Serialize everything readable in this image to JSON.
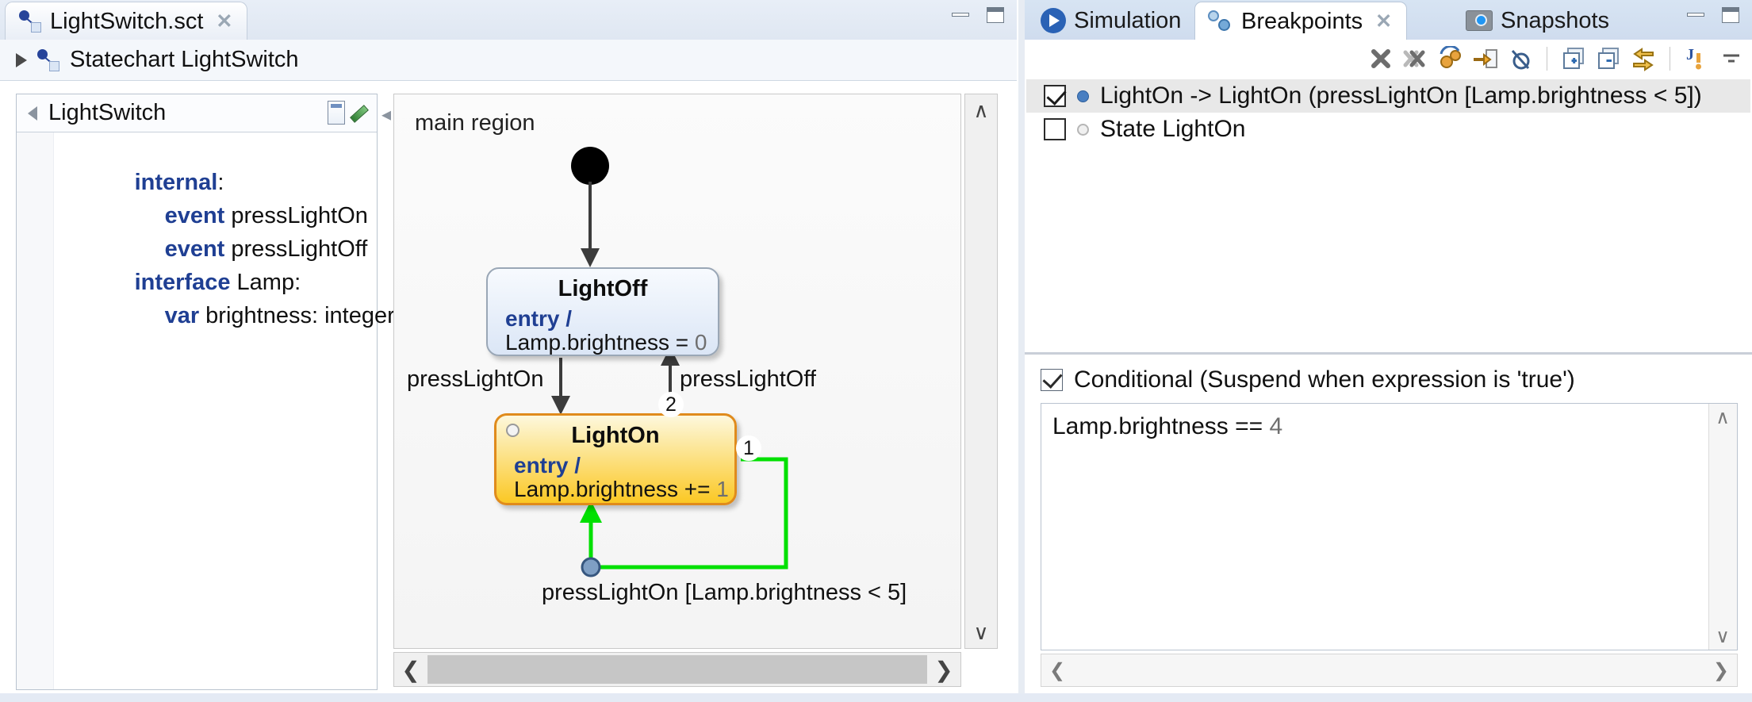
{
  "left_window": {
    "tab": {
      "label": "LightSwitch.sct",
      "icon": "statechart-icon",
      "close": "✕"
    },
    "window_buttons": {
      "minimize": "minimize-icon",
      "maximize": "maximize-icon"
    },
    "breadcrumb": {
      "label": "Statechart LightSwitch",
      "expander": "triangle-right-icon"
    }
  },
  "declarations": {
    "header_title": "LightSwitch",
    "collapse_icon": "triangle-left-icon",
    "tools": [
      "note-icon",
      "pen-icon"
    ],
    "lines": [
      {
        "kw": "internal",
        "rest": ":",
        "indent": 0
      },
      {
        "kw": "event",
        "rest": " pressLightOn",
        "indent": 1
      },
      {
        "kw": "event",
        "rest": " pressLightOff",
        "indent": 1
      },
      {
        "kw": "interface",
        "rest": " Lamp:",
        "indent": 0
      },
      {
        "kw": "var",
        "rest": " brightness: integer",
        "indent": 1
      }
    ]
  },
  "diagram": {
    "region_label": "main region",
    "states": [
      {
        "name": "LightOff",
        "entry_kw": "entry /",
        "action_text": "Lamp.brightness = ",
        "action_value": "0"
      },
      {
        "name": "LightOn",
        "entry_kw": "entry /",
        "action_text": "Lamp.brightness += ",
        "action_value": "1",
        "breakpoint_marker": "state-breakpoint-icon"
      }
    ],
    "transitions": [
      {
        "label": "pressLightOn",
        "number": ""
      },
      {
        "label": "pressLightOff",
        "number": "2"
      },
      {
        "label": "pressLightOn [Lamp.brightness < 5]",
        "number": "1"
      }
    ],
    "scrollbars": {
      "v_up": "∧",
      "v_down": "∨",
      "h_left": "❮",
      "h_right": "❯"
    }
  },
  "right_window": {
    "tabs": [
      {
        "label": "Simulation",
        "icon": "play-icon",
        "active": false
      },
      {
        "label": "Breakpoints",
        "icon": "breakpoints-icon",
        "active": true,
        "close": "✕"
      },
      {
        "label": "Snapshots",
        "icon": "camera-icon",
        "active": false
      }
    ],
    "window_buttons": {
      "minimize": "minimize-icon",
      "maximize": "maximize-icon"
    },
    "toolbar": [
      "remove-breakpoint-icon",
      "remove-all-breakpoints-icon",
      "breakpoint-properties-icon",
      "go-to-file-icon",
      "skip-all-breakpoints-icon",
      "expand-all-icon",
      "collapse-all-icon",
      "link-with-debug-view-icon",
      "java-exception-breakpoint-icon",
      "view-menu-icon"
    ],
    "breakpoints": [
      {
        "checked": true,
        "enabled": true,
        "label": "LightOn -> LightOn (pressLightOn [Lamp.brightness < 5])",
        "selected": true
      },
      {
        "checked": false,
        "enabled": false,
        "label": "State LightOn",
        "selected": false
      }
    ],
    "conditional": {
      "checked": true,
      "label": "Conditional (Suspend when expression is 'true')",
      "expression_text": "Lamp.brightness == ",
      "expression_value": "4"
    },
    "expr_scroll": {
      "up": "∧",
      "down": "∨",
      "left": "❮",
      "right": "❯"
    }
  },
  "colors": {
    "state_active_fill": "#fbc824",
    "state_active_border": "#e08b1c",
    "state_inactive_fill": "#dbe6f6",
    "keyword": "#1f3f93",
    "active_transition": "#00e000",
    "tab_active_bg": "#ffffff"
  }
}
